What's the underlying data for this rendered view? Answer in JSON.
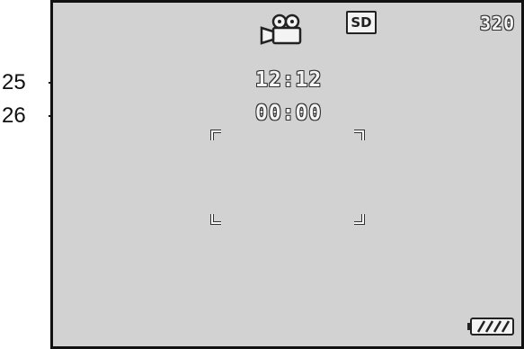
{
  "annotations": {
    "label_25": "25",
    "label_26": "26"
  },
  "screen": {
    "clock": "12:12",
    "recording_time": "00:00",
    "storage_badge": "SD",
    "resolution": "320",
    "mode_icon": "movie-camera-icon",
    "battery_icon": "battery-icon"
  },
  "colors": {
    "lcd_background": "#d2d2d2",
    "lcd_text": "#f4f4f4",
    "outline": "#111111"
  }
}
